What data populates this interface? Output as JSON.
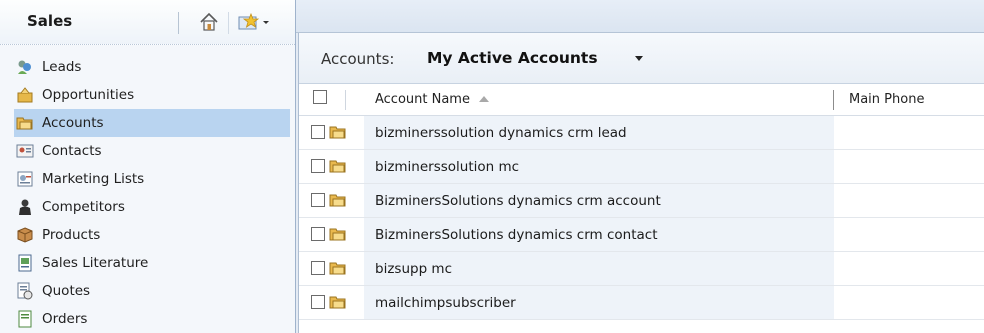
{
  "sidebar": {
    "title": "Sales",
    "items": [
      {
        "label": "Leads",
        "icon": "leads-icon",
        "selected": false
      },
      {
        "label": "Opportunities",
        "icon": "opportunities-icon",
        "selected": false
      },
      {
        "label": "Accounts",
        "icon": "accounts-icon",
        "selected": true
      },
      {
        "label": "Contacts",
        "icon": "contacts-icon",
        "selected": false
      },
      {
        "label": "Marketing Lists",
        "icon": "marketing-lists-icon",
        "selected": false
      },
      {
        "label": "Competitors",
        "icon": "competitors-icon",
        "selected": false
      },
      {
        "label": "Products",
        "icon": "products-icon",
        "selected": false
      },
      {
        "label": "Sales Literature",
        "icon": "sales-literature-icon",
        "selected": false
      },
      {
        "label": "Quotes",
        "icon": "quotes-icon",
        "selected": false
      },
      {
        "label": "Orders",
        "icon": "orders-icon",
        "selected": false
      }
    ]
  },
  "view": {
    "prefix": "Accounts:",
    "name": "My Active Accounts"
  },
  "grid": {
    "columns": [
      "Account Name",
      "Main Phone"
    ],
    "rows": [
      {
        "name": "bizminerssolution dynamics crm lead",
        "phone": ""
      },
      {
        "name": "bizminerssolution mc",
        "phone": ""
      },
      {
        "name": "BizminersSolutions dynamics crm account",
        "phone": ""
      },
      {
        "name": "BizminersSolutions dynamics crm contact",
        "phone": ""
      },
      {
        "name": "bizsupp mc",
        "phone": ""
      },
      {
        "name": "mailchimpsubscriber",
        "phone": ""
      }
    ]
  },
  "colors": {
    "selected_nav": "#b9d4f0",
    "row_highlight": "#eef3f9",
    "accent_border": "#9fb3cc"
  }
}
